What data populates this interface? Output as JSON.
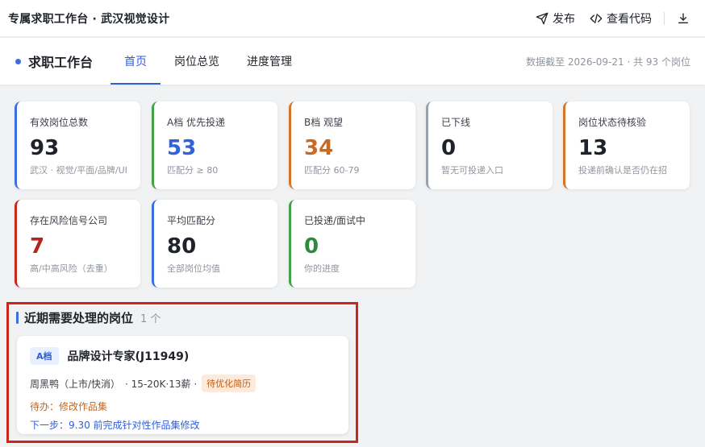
{
  "app": {
    "title": "专属求职工作台 · 武汉视觉设计"
  },
  "toolbar": {
    "publish_label": "发布",
    "view_code_label": "查看代码"
  },
  "nav": {
    "brand": "求职工作台",
    "tabs": [
      {
        "label": "首页",
        "active": true
      },
      {
        "label": "岗位总览",
        "active": false
      },
      {
        "label": "进度管理",
        "active": false
      }
    ],
    "data_note": "数据截至 2026-09-21 · 共 93 个岗位"
  },
  "stats": [
    {
      "label": "有效岗位总数",
      "value": "93",
      "sub": "武汉 · 视觉/平面/品牌/UI",
      "accent": "#3d6ee0",
      "value_color": "#1f2329"
    },
    {
      "label": "A档 优先投递",
      "value": "53",
      "sub": "匹配分 ≥ 80",
      "accent": "#43a047",
      "value_color": "#3262d6"
    },
    {
      "label": "B档 观望",
      "value": "34",
      "sub": "匹配分 60-79",
      "accent": "#d2762b",
      "value_color": "#c96a24"
    },
    {
      "label": "已下线",
      "value": "0",
      "sub": "暂无可投递入口",
      "accent": "#9aa0a8",
      "value_color": "#1f2329"
    },
    {
      "label": "岗位状态待核验",
      "value": "13",
      "sub": "投递前确认是否仍在招",
      "accent": "#d2762b",
      "value_color": "#1f2329"
    },
    {
      "label": "存在风险信号公司",
      "value": "7",
      "sub": "高/中高风险（去重）",
      "accent": "#c9261c",
      "value_color": "#b3261e"
    },
    {
      "label": "平均匹配分",
      "value": "80",
      "sub": "全部岗位均值",
      "accent": "#3d6ee0",
      "value_color": "#1f2329"
    },
    {
      "label": "已投递/面试中",
      "value": "0",
      "sub": "你的进度",
      "accent": "#43a047",
      "value_color": "#2e8b3e"
    }
  ],
  "pending": {
    "title": "近期需要处理的岗位",
    "count": "1 个",
    "jobs": [
      {
        "tier": "A档",
        "title": "品牌设计专家(J11949)",
        "company": "周黑鸭（上市/快消）",
        "salary": "· 15-20K·13薪 ·",
        "status": "待优化简历",
        "todo": "待办：修改作品集",
        "next": "下一步：9.30 前完成针对性作品集修改"
      }
    ]
  }
}
